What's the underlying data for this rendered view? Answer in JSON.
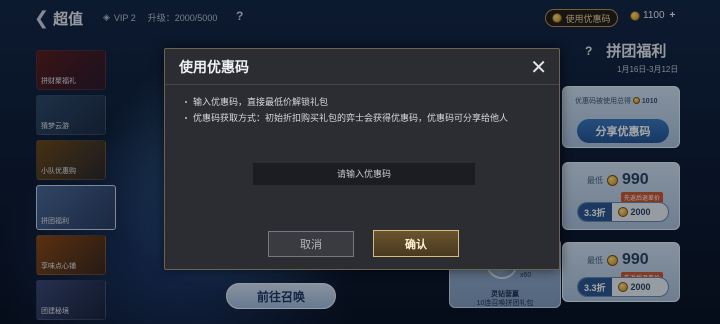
{
  "topbar": {
    "back_label": "超值",
    "vip_label": "VIP 2",
    "upgrade_label": "升级：2000/5000",
    "help": "?",
    "coupon_button": "使用优惠码",
    "coins": "1100",
    "plus": "+"
  },
  "menu": {
    "items": [
      {
        "label": "拼财聚福礼"
      },
      {
        "label": "猜梦云游"
      },
      {
        "label": "小队优惠购"
      },
      {
        "label": "拼团福利"
      },
      {
        "label": "享味点心铺"
      },
      {
        "label": "团建秘境"
      }
    ]
  },
  "panel": {
    "help": "?",
    "title": "拼团福利",
    "date": "1月16日-3月12日",
    "card1": {
      "note_prefix": "优惠码被使用总得",
      "note_value": "1010",
      "button": "分享优惠码"
    },
    "card2": {
      "label": "最低",
      "price": "990",
      "tag": "先返后退差价",
      "discount": "3.3折",
      "amount": "2000"
    },
    "card3": {
      "label": "最低",
      "price": "990",
      "tag": "先返后退差价",
      "discount": "3.3折",
      "amount": "2000"
    },
    "gift": {
      "count": "x60",
      "line1": "灵钻营赢",
      "line2": "10连召唤拼团礼包"
    },
    "goto_button": "前往召唤"
  },
  "dialog": {
    "title": "使用优惠码",
    "rule1": "输入优惠码，直接最低价解锁礼包",
    "rule2": "优惠码获取方式：初始折扣购买礼包的弈士会获得优惠码，优惠码可分享给他人",
    "input_placeholder": "请输入优惠码",
    "input_value": "",
    "cancel": "取消",
    "confirm": "确认",
    "close": "✕"
  },
  "colors": {
    "accent_gold": "#d8bc7c",
    "dialog_bg": "#2c2d33",
    "button_blue": "#2c5a96"
  }
}
